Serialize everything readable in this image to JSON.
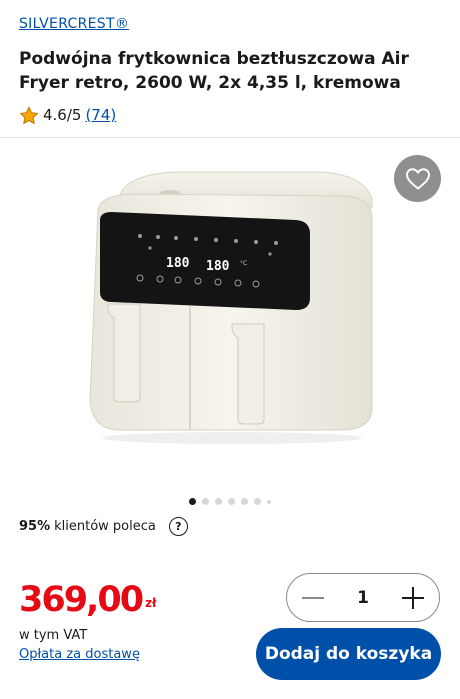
{
  "product": {
    "brand": "SILVERCREST®",
    "title": "Podwójna frytkownica beztłuszczowa Air Fryer retro, 2600 W, 2x 4,35 l, kremowa",
    "rating": "4.6/5",
    "rating_count": "(74)",
    "display_left": "180",
    "display_right": "180",
    "display_unit": "°C"
  },
  "gallery": {
    "dot_count": 7,
    "active_index": 0
  },
  "recommend": {
    "percent": "95%",
    "text": "klientów poleca",
    "help": "?"
  },
  "price": {
    "amount": "369,00",
    "currency": "zł",
    "vat": "w tym VAT",
    "shipping_link": "Opłata za dostawę"
  },
  "cart": {
    "quantity": "1",
    "add_label": "Dodaj do koszyka"
  },
  "colors": {
    "link": "#0050aa",
    "price": "#e60a14",
    "cta": "#0050aa",
    "star": "#f7a600"
  },
  "icons": {
    "star": "star-icon",
    "heart": "heart-icon",
    "minus": "minus-icon",
    "plus": "plus-icon",
    "help": "question-icon"
  }
}
